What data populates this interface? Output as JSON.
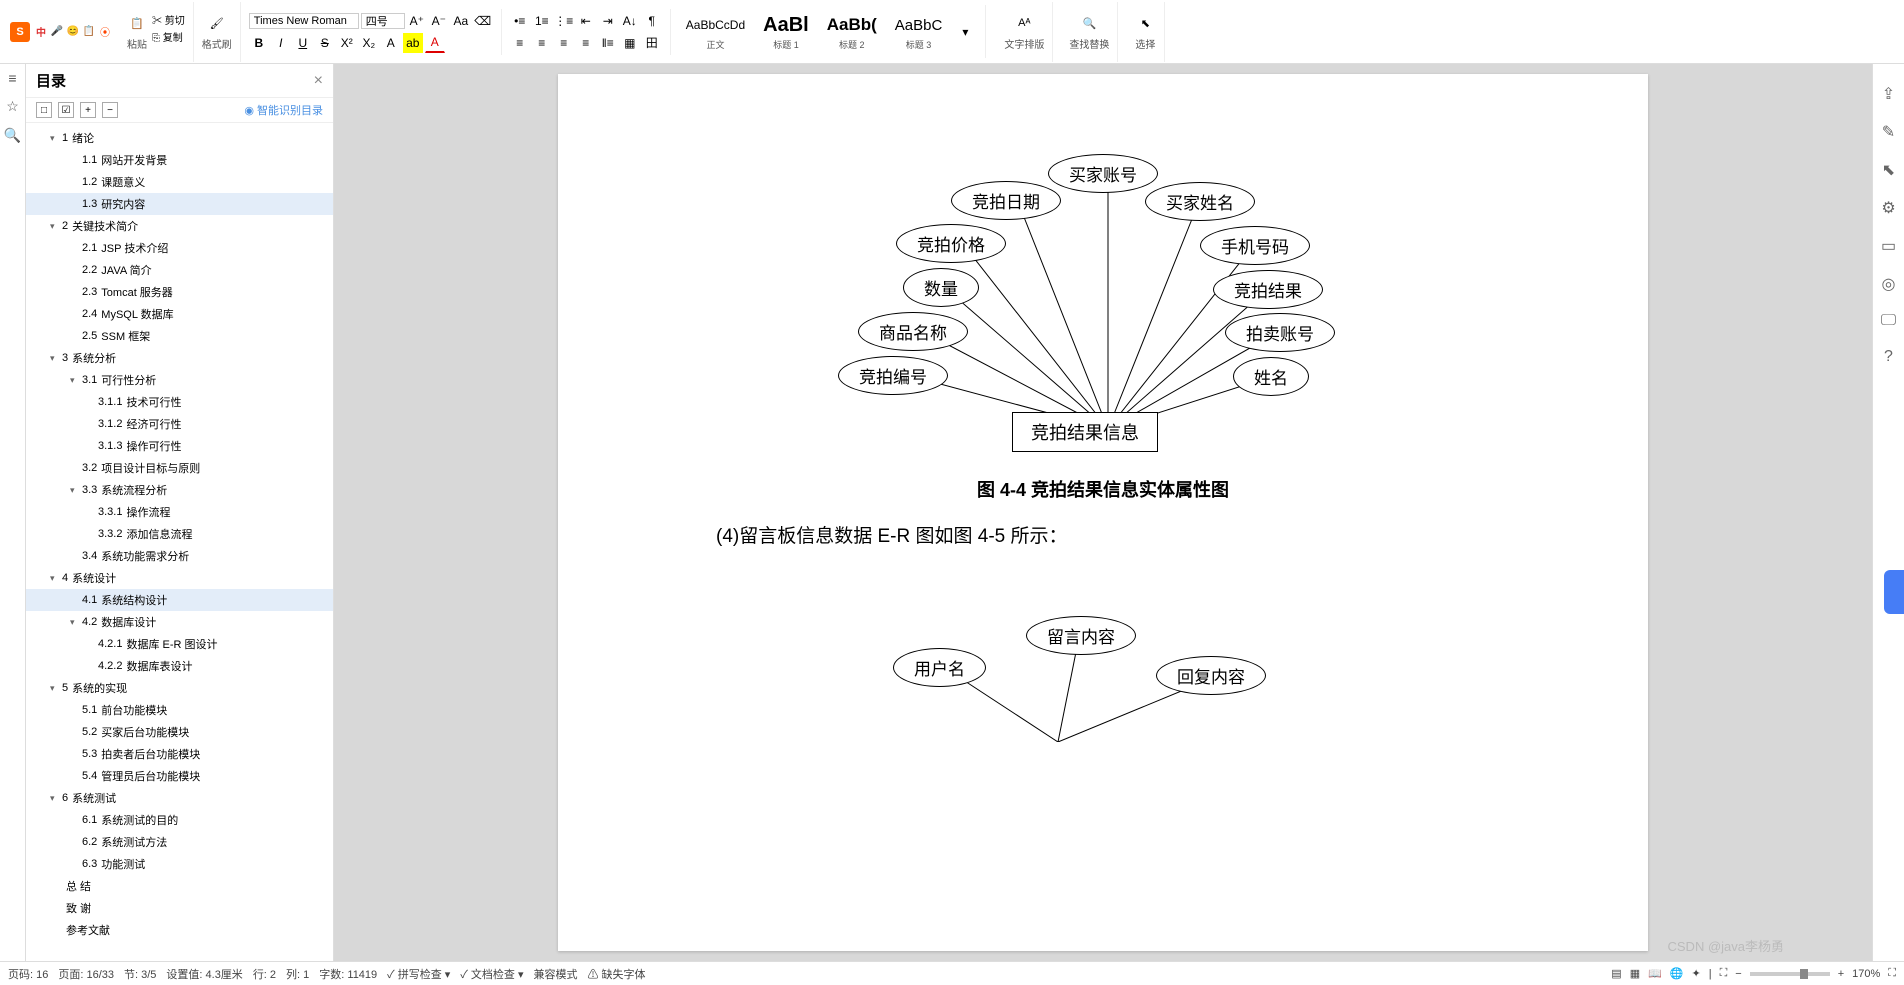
{
  "topbar": {
    "lang": "中",
    "cut": "剪切",
    "copy": "复制",
    "paste": "粘贴",
    "format_painter": "格式刷",
    "font_name": "Times New Roman",
    "font_size": "四号",
    "text_layout": "文字排版",
    "find_replace": "查找替换",
    "select": "选择"
  },
  "styles": [
    {
      "preview": "AaBbCcDd",
      "name": "正文",
      "weight": "normal",
      "size": "12px"
    },
    {
      "preview": "AaBl",
      "name": "标题 1",
      "weight": "bold",
      "size": "20px"
    },
    {
      "preview": "AaBb(",
      "name": "标题 2",
      "weight": "bold",
      "size": "17px"
    },
    {
      "preview": "AaBbC",
      "name": "标题 3",
      "weight": "normal",
      "size": "15px"
    }
  ],
  "outline": {
    "title": "目录",
    "smart": "智能识别目录",
    "items": [
      {
        "level": 1,
        "chevron": true,
        "num": "1",
        "text": "绪论"
      },
      {
        "level": 2,
        "num": "1.1",
        "text": "网站开发背景"
      },
      {
        "level": 2,
        "num": "1.2",
        "text": "课题意义"
      },
      {
        "level": 2,
        "num": "1.3",
        "text": "研究内容",
        "selected": true
      },
      {
        "level": 1,
        "chevron": true,
        "num": "2",
        "text": "关键技术简介"
      },
      {
        "level": 2,
        "num": "2.1",
        "text": "JSP 技术介绍"
      },
      {
        "level": 2,
        "num": "2.2",
        "text": "JAVA 简介"
      },
      {
        "level": 2,
        "num": "2.3",
        "text": "Tomcat 服务器"
      },
      {
        "level": 2,
        "num": "2.4",
        "text": "MySQL 数据库"
      },
      {
        "level": 2,
        "num": "2.5",
        "text": "SSM 框架"
      },
      {
        "level": 1,
        "chevron": true,
        "num": "3",
        "text": "系统分析"
      },
      {
        "level": 2,
        "chevron": true,
        "num": "3.1",
        "text": "可行性分析"
      },
      {
        "level": 3,
        "num": "3.1.1",
        "text": "技术可行性"
      },
      {
        "level": 3,
        "num": "3.1.2",
        "text": "经济可行性"
      },
      {
        "level": 3,
        "num": "3.1.3",
        "text": "操作可行性"
      },
      {
        "level": 2,
        "num": "3.2",
        "text": "项目设计目标与原则"
      },
      {
        "level": 2,
        "chevron": true,
        "num": "3.3",
        "text": "系统流程分析"
      },
      {
        "level": 3,
        "num": "3.3.1",
        "text": "操作流程"
      },
      {
        "level": 3,
        "num": "3.3.2",
        "text": "添加信息流程"
      },
      {
        "level": 2,
        "num": "3.4",
        "text": "系统功能需求分析"
      },
      {
        "level": 1,
        "chevron": true,
        "num": "4",
        "text": "系统设计"
      },
      {
        "level": 2,
        "num": "4.1",
        "text": "系统结构设计",
        "selected": true
      },
      {
        "level": 2,
        "chevron": true,
        "num": "4.2",
        "text": "数据库设计"
      },
      {
        "level": 3,
        "num": "4.2.1",
        "text": "数据库 E-R 图设计"
      },
      {
        "level": 3,
        "num": "4.2.2",
        "text": "数据库表设计"
      },
      {
        "level": 1,
        "chevron": true,
        "num": "5",
        "text": "系统的实现"
      },
      {
        "level": 2,
        "num": "5.1",
        "text": "前台功能模块"
      },
      {
        "level": 2,
        "num": "5.2",
        "text": "买家后台功能模块"
      },
      {
        "level": 2,
        "num": "5.3",
        "text": "拍卖者后台功能模块"
      },
      {
        "level": 2,
        "num": "5.4",
        "text": "管理员后台功能模块"
      },
      {
        "level": 1,
        "chevron": true,
        "num": "6",
        "text": "系统测试"
      },
      {
        "level": 2,
        "num": "6.1",
        "text": "系统测试的目的"
      },
      {
        "level": 2,
        "num": "6.2",
        "text": "系统测试方法"
      },
      {
        "level": 2,
        "num": "6.3",
        "text": "功能测试"
      },
      {
        "level": 1,
        "num": "",
        "text": "总 结"
      },
      {
        "level": 1,
        "num": "",
        "text": "致 谢"
      },
      {
        "level": 1,
        "num": "",
        "text": "参考文献"
      }
    ]
  },
  "doc": {
    "caption1": "图 4-4  竞拍结果信息实体属性图",
    "body1": "(4)留言板信息数据 E-R 图如图 4-5 所示：",
    "er1_center": "竞拍结果信息",
    "er1_attrs": [
      "竞拍编号",
      "商品名称",
      "数量",
      "竞拍价格",
      "竞拍日期",
      "买家账号",
      "买家姓名",
      "手机号码",
      "竞拍结果",
      "拍卖账号",
      "姓名"
    ],
    "er2_attrs": [
      "用户名",
      "留言内容",
      "回复内容"
    ]
  },
  "status": {
    "pages": "页码: 16",
    "page_of": "页面: 16/33",
    "section": "节: 3/5",
    "setting": "设置值: 4.3厘米",
    "line": "行: 2",
    "col": "列: 1",
    "words": "字数: 11419",
    "spell": "拼写检查",
    "doc_check": "文档检查",
    "compat": "兼容模式",
    "missing_font": "缺失字体",
    "zoom": "170%"
  },
  "watermark": "CSDN @java李杨勇"
}
